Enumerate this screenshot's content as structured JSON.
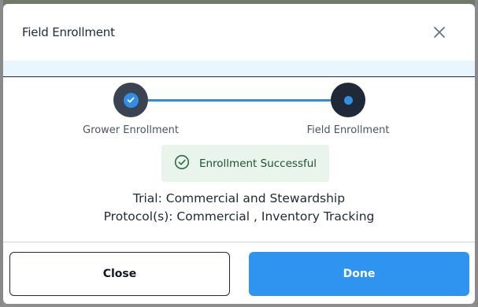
{
  "modal": {
    "title": "Field Enrollment"
  },
  "stepper": {
    "steps": [
      {
        "label": "Grower Enrollment",
        "state": "completed"
      },
      {
        "label": "Field Enrollment",
        "state": "current"
      }
    ]
  },
  "status": {
    "message": "Enrollment Successful"
  },
  "details": {
    "trial": "Trial: Commercial and Stewardship",
    "protocols": "Protocol(s): Commercial , Inventory Tracking"
  },
  "footer": {
    "close_label": "Close",
    "done_label": "Done"
  },
  "colors": {
    "accent": "#2f93f0",
    "success_bg": "#e8f4ec",
    "success_text": "#1f5132",
    "step_node": "#1f2937"
  }
}
